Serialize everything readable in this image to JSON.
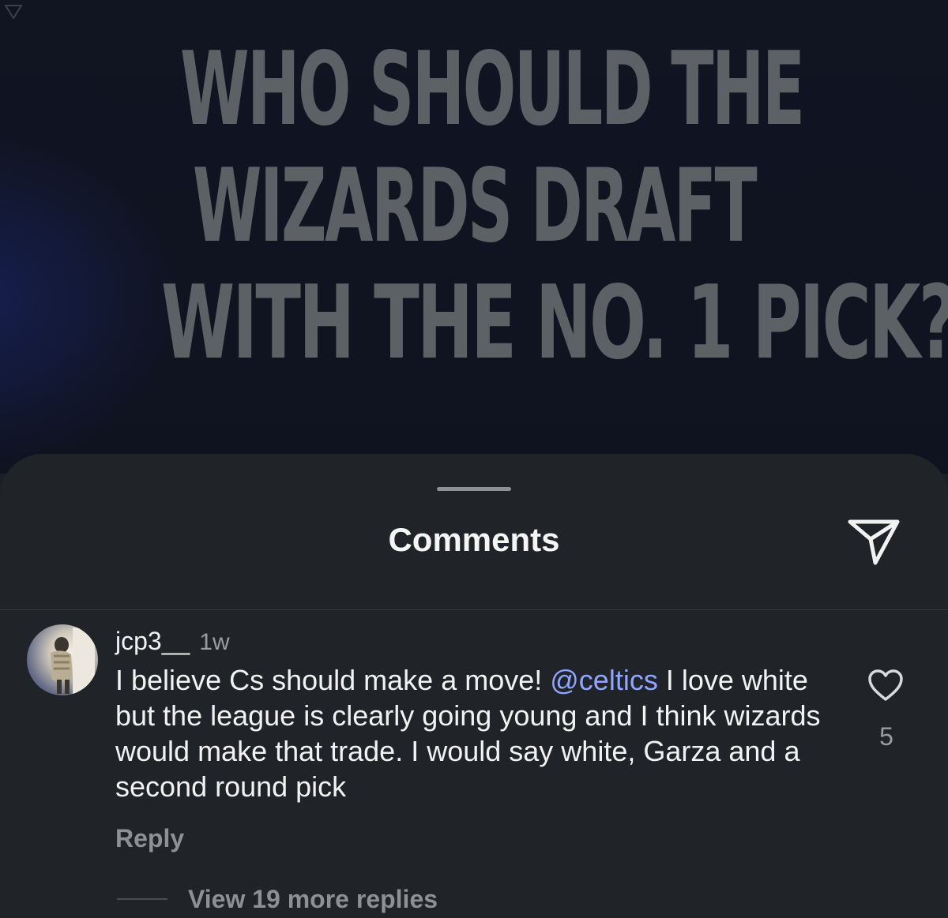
{
  "post": {
    "headline_lines": [
      "WHO SHOULD THE",
      "WIZARDS DRAFT",
      "WITH THE NO. 1 PICK?"
    ],
    "headline_color": "#5d6166"
  },
  "sheet": {
    "title": "Comments",
    "share_icon": "paper-plane-icon"
  },
  "comment": {
    "username": "jcp3__",
    "timestamp": "1w",
    "text_before_mention": "I believe Cs should make a move! ",
    "mention": "@celtics",
    "text_after_mention": " I love white but the league is clearly going young and I think wizards would make that trade. I would say white, Garza and a second round pick",
    "like_icon": "heart-outline-icon",
    "like_count": "5",
    "reply_label": "Reply",
    "view_replies_label": "View 19 more replies"
  },
  "colors": {
    "background": "#202327",
    "mention": "#8fa5ff",
    "secondary_text": "#9a9ca1"
  }
}
